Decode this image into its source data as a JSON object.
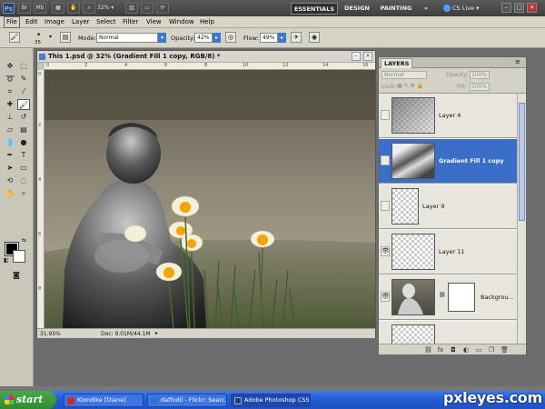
{
  "app": {
    "logo": "Ps",
    "zoom": "32%",
    "workspaces": [
      "ESSENTIALS",
      "DESIGN",
      "PAINTING"
    ],
    "more": "»",
    "cslive": "CS Live",
    "window_controls": [
      "–",
      "□",
      "×"
    ],
    "appbar_icons": [
      "Br",
      "Mb"
    ]
  },
  "menu": [
    "File",
    "Edit",
    "Image",
    "Layer",
    "Select",
    "Filter",
    "View",
    "Window",
    "Help"
  ],
  "options": {
    "brush_size": "35",
    "mode_label": "Mode:",
    "mode_value": "Normal",
    "opacity_label": "Opacity:",
    "opacity_value": "42%",
    "flow_label": "Flow:",
    "flow_value": "49%"
  },
  "document": {
    "title": "This 1.psd @ 32% (Gradient Fill 1 copy, RGB/8) *",
    "zoom_status": "31.95%",
    "doc_status": "Doc: 9.01M/44.1M",
    "ruler_marks": [
      "0",
      "2",
      "4",
      "6",
      "8",
      "10",
      "12",
      "14",
      "16"
    ]
  },
  "layers_panel": {
    "tab": "LAYERS",
    "blend_mode": "Normal",
    "opacity_label": "Opacity:",
    "opacity_value": "100%",
    "lock_label": "Lock:",
    "fill_label": "Fill:",
    "fill_value": "100%",
    "layers": [
      {
        "name": "Layer 4",
        "visible": false,
        "selected": false
      },
      {
        "name": "Gradient Fill 1 copy",
        "visible": false,
        "selected": true
      },
      {
        "name": "Layer 9",
        "visible": false,
        "selected": false
      },
      {
        "name": "Layer 11",
        "visible": true,
        "selected": false
      },
      {
        "name": "Backgrou...",
        "visible": true,
        "selected": false
      }
    ]
  },
  "taskbar": {
    "start": "start",
    "tasks": [
      "Klondike [Diane]",
      "daffodil - Flickr: Searc...",
      "Adobe Photoshop CS5"
    ]
  },
  "watermark": "pxleyes.com"
}
